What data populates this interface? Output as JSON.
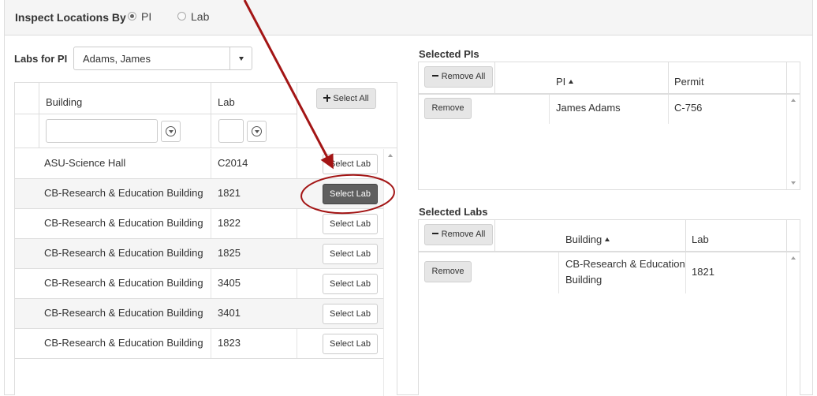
{
  "header": {
    "title": "Inspect Locations By",
    "options": [
      {
        "label": "PI",
        "checked": true
      },
      {
        "label": "Lab",
        "checked": false
      }
    ]
  },
  "labs_for_pi": {
    "label": "Labs for PI",
    "selected": "Adams, James"
  },
  "labs_table": {
    "columns": {
      "building": "Building",
      "lab": "Lab"
    },
    "select_all_label": "Select All",
    "building_filter": "",
    "lab_filter": "",
    "rows": [
      {
        "building": "ASU-Science Hall",
        "lab": "C2014",
        "action": "Select Lab"
      },
      {
        "building": "CB-Research & Education Building",
        "lab": "1821",
        "action": "Select Lab"
      },
      {
        "building": "CB-Research & Education Building",
        "lab": "1822",
        "action": "Select Lab"
      },
      {
        "building": "CB-Research & Education Building",
        "lab": "1825",
        "action": "Select Lab"
      },
      {
        "building": "CB-Research & Education Building",
        "lab": "3405",
        "action": "Select Lab"
      },
      {
        "building": "CB-Research & Education Building",
        "lab": "3401",
        "action": "Select Lab"
      },
      {
        "building": "CB-Research & Education Building",
        "lab": "1823",
        "action": "Select Lab"
      }
    ]
  },
  "selected_pis": {
    "title": "Selected PIs",
    "remove_all_label": "Remove All",
    "columns": {
      "pi": "PI",
      "permit": "Permit"
    },
    "rows": [
      {
        "action": "Remove",
        "pi": "James Adams",
        "permit": "C-756"
      }
    ]
  },
  "selected_labs": {
    "title": "Selected Labs",
    "remove_all_label": "Remove All",
    "columns": {
      "building": "Building",
      "lab": "Lab"
    },
    "rows": [
      {
        "action": "Remove",
        "building_line1": "CB-Research & Education",
        "building_line2": "Building",
        "lab": "1821"
      }
    ]
  },
  "annotation": {
    "arrow_color": "#a31515",
    "highlight_color": "#a31515"
  }
}
